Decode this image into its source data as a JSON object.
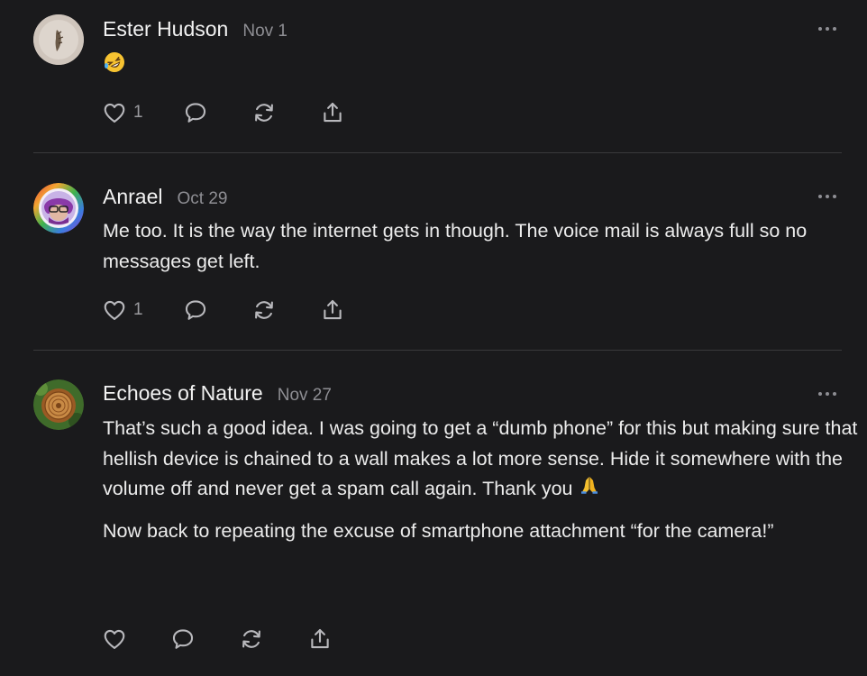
{
  "comments": [
    {
      "author": "Ester Hudson",
      "date": "Nov 1",
      "paragraphs": [],
      "emoji": "rofl-emoji",
      "like_count": "1"
    },
    {
      "author": "Anrael",
      "date": "Oct 29",
      "paragraphs": [
        "Me too. It is the way the internet gets in though. The voice mail is always full so no messages get left."
      ],
      "like_count": "1"
    },
    {
      "author": "Echoes of Nature",
      "date": "Nov 27",
      "paragraphs": [
        "That’s such a good idea. I was going to get a “dumb phone” for this but making sure that hellish device is chained to a wall makes a lot more sense. Hide it somewhere with the volume off and never get a spam call again. Thank you",
        "Now back to repeating the excuse of smartphone attachment “for the camera!”"
      ],
      "inline_emoji": "praying-hands-emoji",
      "like_count": ""
    }
  ],
  "icons": {
    "like": "heart-icon",
    "reply": "speech-bubble-icon",
    "restack": "restack-arrows-icon",
    "share": "share-upload-icon",
    "more": "more-dots-icon"
  },
  "colors": {
    "background": "#1a1a1c",
    "text": "#ececec",
    "muted": "#8e8e93",
    "divider": "#3a3a3c"
  }
}
